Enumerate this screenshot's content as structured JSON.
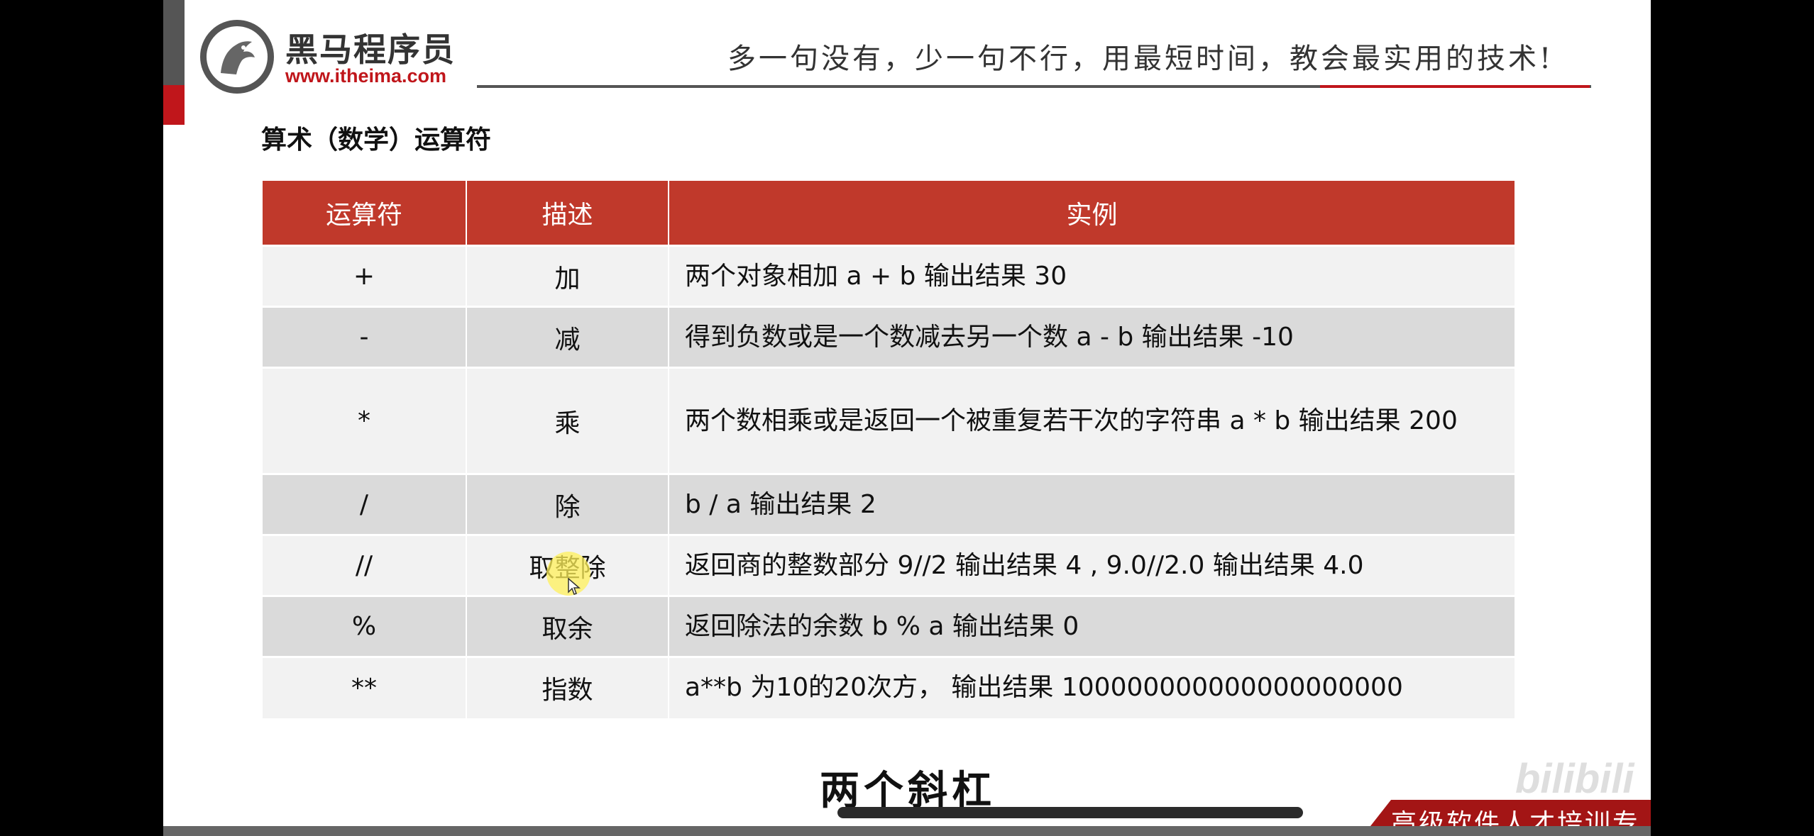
{
  "brand": {
    "name_cn": "黑马程序员",
    "url": "www.itheima.com"
  },
  "slogan": "多一句没有，少一句不行，用最短时间，教会最实用的技术!",
  "section_title": "算术（数学）运算符",
  "table": {
    "headers": [
      "运算符",
      "描述",
      "实例"
    ],
    "rows": [
      {
        "op": "+",
        "desc": "加",
        "example": "两个对象相加 a + b 输出结果 30"
      },
      {
        "op": "-",
        "desc": "减",
        "example": "得到负数或是一个数减去另一个数 a - b 输出结果 -10"
      },
      {
        "op": "*",
        "desc": "乘",
        "example": "两个数相乘或是返回一个被重复若干次的字符串 a * b 输出结果 200"
      },
      {
        "op": "/",
        "desc": "除",
        "example": "b / a 输出结果 2"
      },
      {
        "op": "//",
        "desc": "取整除",
        "example": "返回商的整数部分 9//2 输出结果 4 , 9.0//2.0 输出结果 4.0"
      },
      {
        "op": "%",
        "desc": "取余",
        "example": "返回除法的余数 b % a 输出结果 0"
      },
      {
        "op": "**",
        "desc": "指数",
        "example": "a**b 为10的20次方， 输出结果 100000000000000000000"
      }
    ]
  },
  "subtitle": "两个斜杠",
  "watermark": "bilibili",
  "footer": "高级软件人才培训专家",
  "colors": {
    "brand_red": "#c0161b",
    "header_red": "#c0392b",
    "row_light": "#f2f2f2",
    "row_dark": "#dadada"
  }
}
